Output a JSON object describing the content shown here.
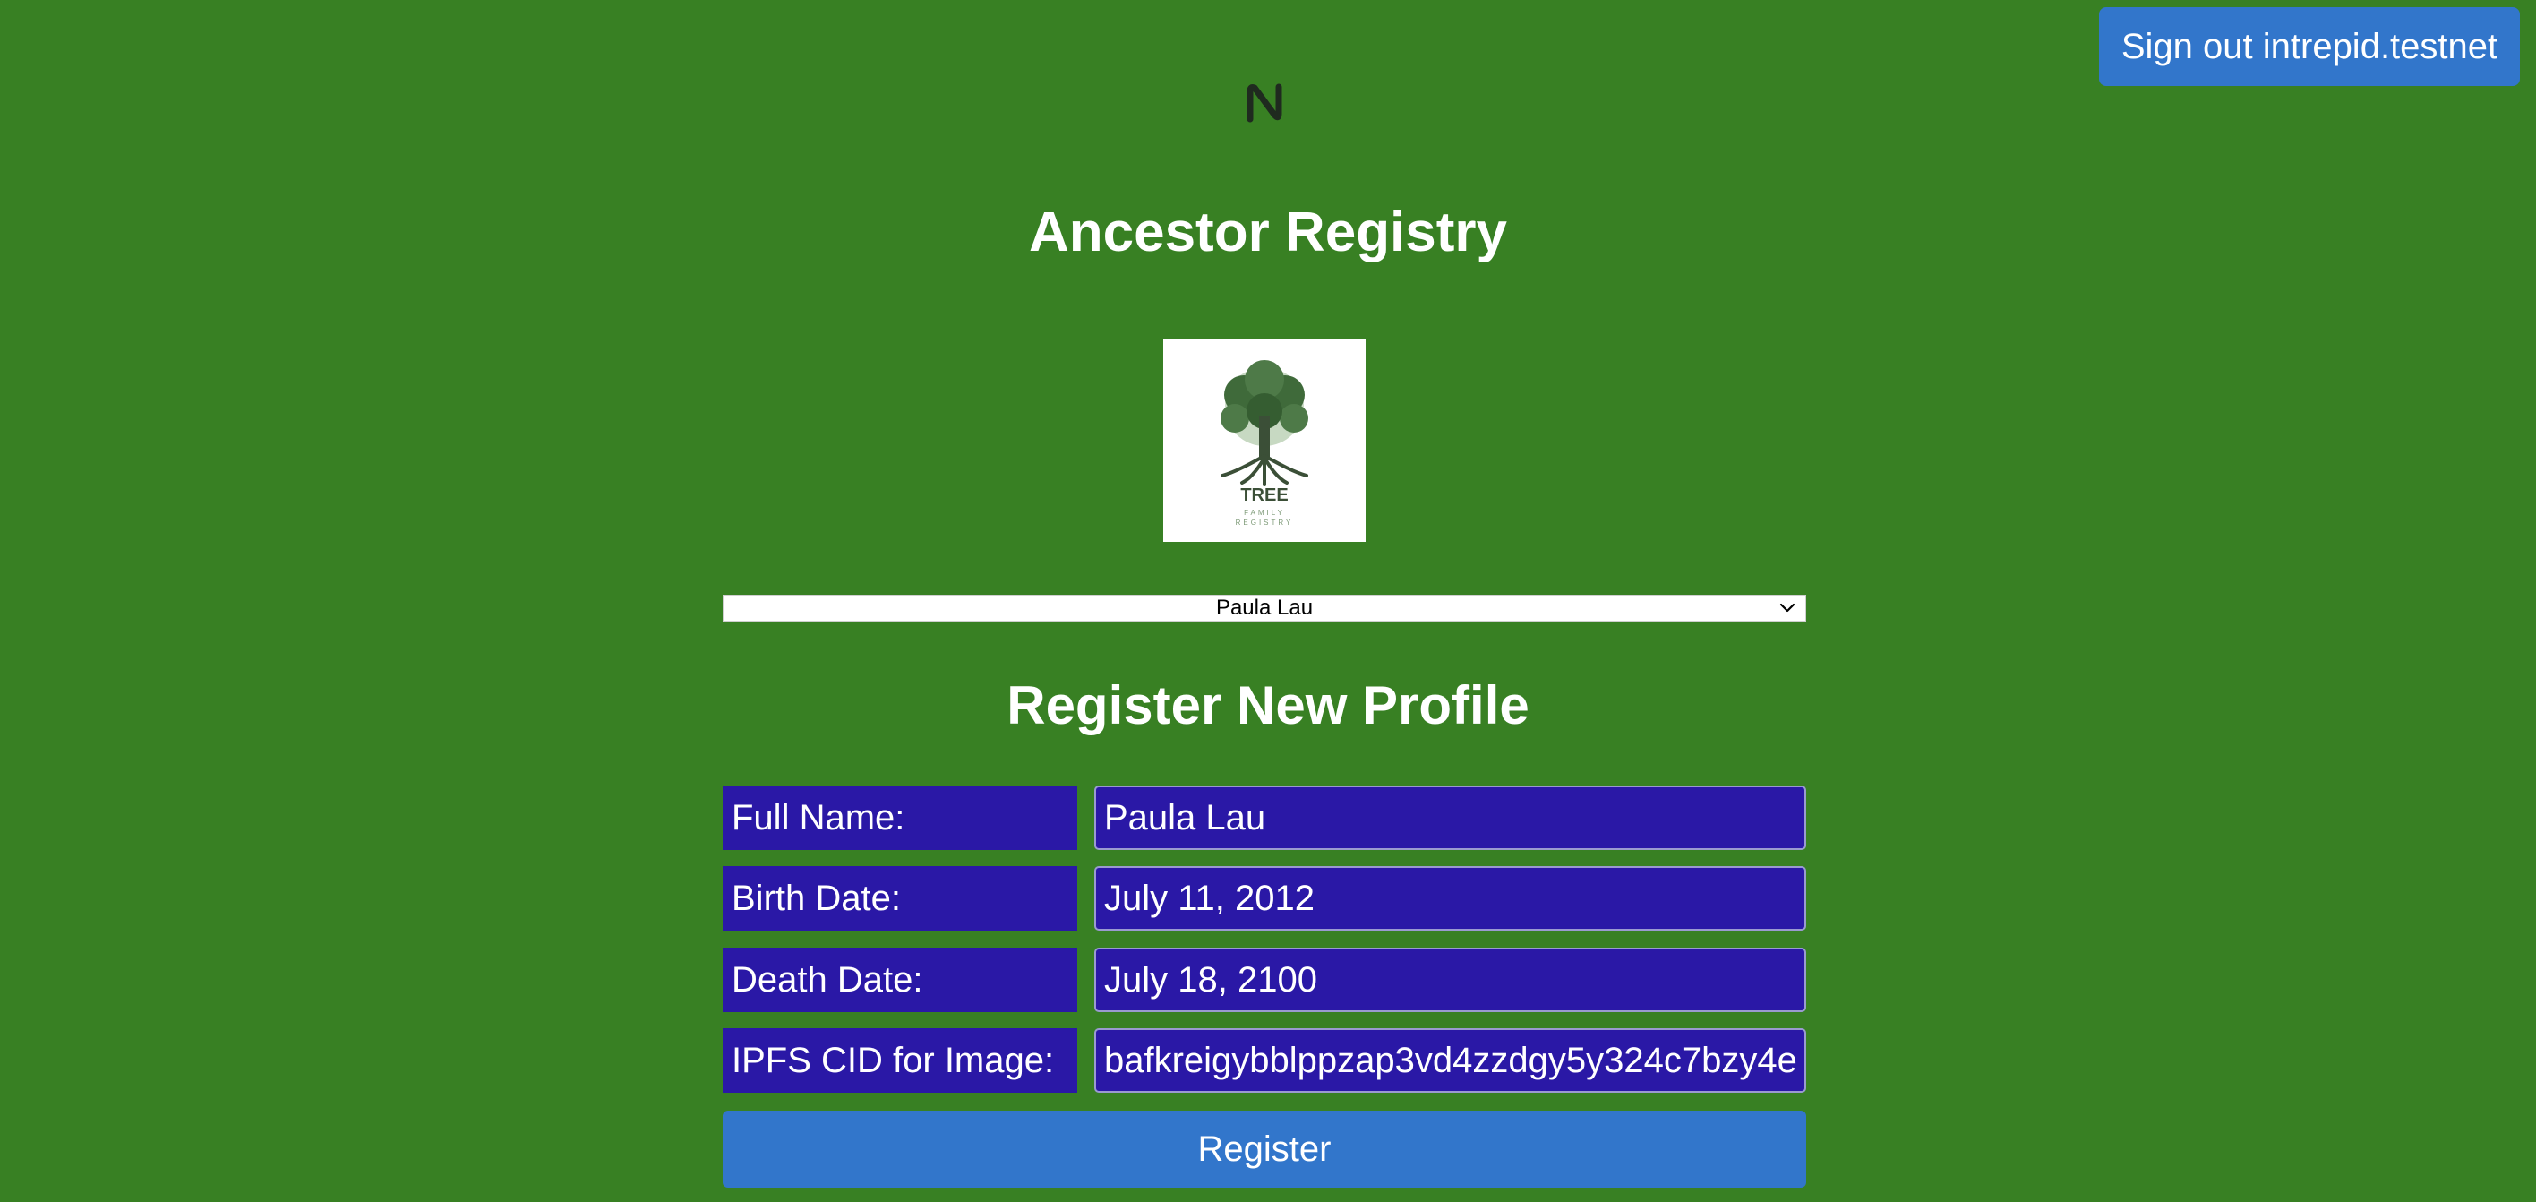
{
  "header": {
    "signout_label": "Sign out intrepid.testnet",
    "logo_icon": "near-logo-icon"
  },
  "app": {
    "title": "Ancestor Registry",
    "logo_image": {
      "icon": "tree-logo-icon",
      "text": "TREE",
      "subtext_1": "FAMILY",
      "subtext_2": "REGISTRY"
    }
  },
  "profile_select": {
    "selected": "Paula Lau",
    "icon": "chevron-down-icon"
  },
  "form": {
    "title": "Register New Profile",
    "fields": [
      {
        "label": "Full Name:",
        "value": "Paula Lau"
      },
      {
        "label": "Birth Date:",
        "value": "July 11, 2012"
      },
      {
        "label": "Death Date:",
        "value": "July 18, 2100"
      },
      {
        "label": "IPFS CID for Image:",
        "value": "bafkreigybblppzap3vd4zzdgy5y324c7bzy4e"
      }
    ],
    "submit_label": "Register"
  },
  "colors": {
    "background": "#388023",
    "button": "#3276cb",
    "field": "#2a18a6"
  }
}
